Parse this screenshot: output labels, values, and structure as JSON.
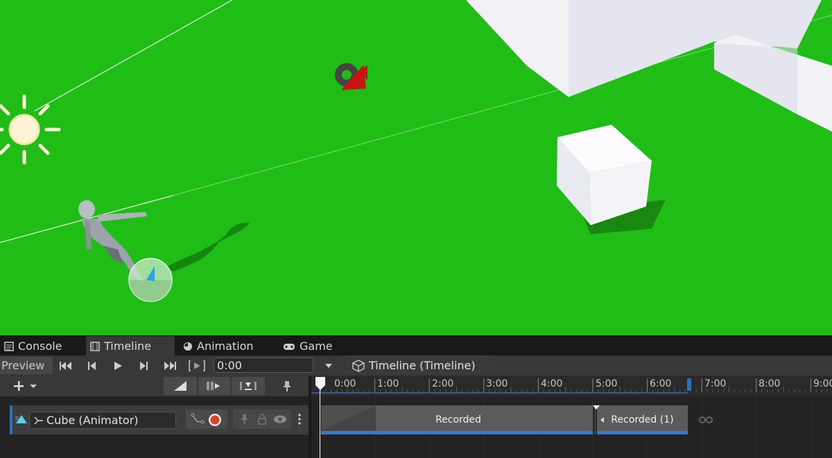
{
  "tabs": [
    {
      "label": "Console",
      "icon": "console-icon"
    },
    {
      "label": "Timeline",
      "icon": "timeline-film-icon",
      "active": true
    },
    {
      "label": "Animation",
      "icon": "animation-clock-icon"
    },
    {
      "label": "Game",
      "icon": "gamepad-icon"
    }
  ],
  "toolbar": {
    "preview_label": "Preview",
    "time_value": "0:00",
    "breadcrumb": "Timeline (Timeline)",
    "playback_icons": [
      "go-to-start-icon",
      "previous-frame-icon",
      "play-icon",
      "next-frame-icon",
      "go-to-end-icon",
      "play-range-icon"
    ]
  },
  "ruler": {
    "ticks": [
      "0:00",
      "1:00",
      "2:00",
      "3:00",
      "4:00",
      "5:00",
      "6:00",
      "7:00",
      "8:00",
      "9:00"
    ]
  },
  "track": {
    "binding_label": "Cube (Animator)",
    "clips": [
      {
        "label": "Recorded"
      },
      {
        "label": "Recorded (1)"
      }
    ]
  },
  "colors": {
    "scene_ground": "#1fbd16",
    "accent_blue": "#3e7bc4",
    "record_red": "#d9442b",
    "panel": "#383838"
  }
}
